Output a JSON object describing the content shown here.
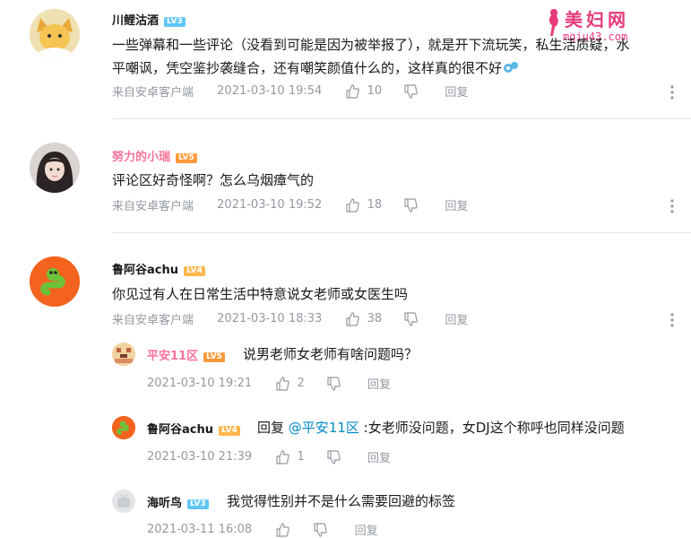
{
  "watermark": {
    "title": "美妇网",
    "url": "mgiu43.com",
    "brand_color": "#e63b7a"
  },
  "colors": {
    "name_default": "#18191c",
    "name_vip": "#fb7299",
    "meta": "#9499a0",
    "link": "#008ac5",
    "lv3": "#61c7f7",
    "lv5": "#ff9a3c"
  },
  "comments": [
    {
      "user": "川鲤沽酒",
      "level": "LV3",
      "avatar_icon": "cartoon-fox-avatar",
      "text_line1": "一些弹幕和一些评论（没看到可能是因为被举报了），就是开下流玩笑，私生活质疑，水",
      "text_line2": "平嘲讽，凭空鉴抄袭缝合，还有嘲笑颜值什么的，这样真的很不好",
      "emoji": "tear-emoji",
      "source": "来自安卓客户端",
      "time": "2021-03-10 19:54",
      "likes": "10",
      "reply": "回复"
    },
    {
      "user": "努力的小瑞",
      "level": "LV5",
      "avatar_icon": "girl-photo-avatar",
      "text_line1": "评论区好奇怪啊？怎么乌烟瘴气的",
      "source": "来自安卓客户端",
      "time": "2021-03-10 19:52",
      "likes": "18",
      "reply": "回复"
    },
    {
      "user": "鲁阿谷achu",
      "level": "LV4",
      "avatar_icon": "green-snake-avatar",
      "text_line1": "你见过有人在日常生活中特意说女老师或女医生吗",
      "source": "来自安卓客户端",
      "time": "2021-03-10 18:33",
      "likes": "38",
      "reply": "回复",
      "replies": [
        {
          "user": "平安11区",
          "level": "LV5",
          "text": "说男老师女老师有啥问题吗？",
          "time": "2021-03-10 19:21",
          "likes": "2",
          "reply": "回复"
        },
        {
          "user": "鲁阿谷achu",
          "level": "LV4",
          "reply_prefix": "回复",
          "mention": "@平安11区",
          "text": ":女老师没问题，女DJ这个称呼也同样没问题",
          "time": "2021-03-10 21:39",
          "likes": "1",
          "reply": "回复"
        },
        {
          "user": "海听鸟",
          "level": "LV3",
          "text": "我觉得性别并不是什么需要回避的标签",
          "time": "2021-03-11 16:08",
          "likes": "",
          "reply": "回复"
        }
      ]
    }
  ]
}
